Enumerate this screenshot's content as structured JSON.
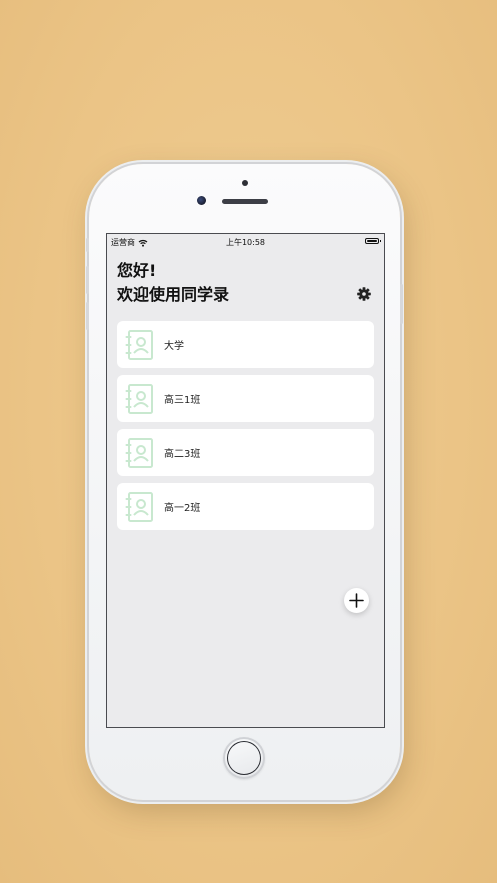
{
  "status_bar": {
    "carrier": "运营商",
    "time": "上午10:58",
    "battery_level": 1.0
  },
  "header": {
    "greeting": "您好!",
    "title": "欢迎使用同学录",
    "settings_icon": "gear-icon"
  },
  "classes": [
    {
      "label": "大学",
      "icon": "address-book-icon"
    },
    {
      "label": "高三1班",
      "icon": "address-book-icon"
    },
    {
      "label": "高二3班",
      "icon": "address-book-icon"
    },
    {
      "label": "高一2班",
      "icon": "address-book-icon"
    }
  ],
  "add_button": {
    "icon": "plus-icon"
  },
  "colors": {
    "background": "#ebc486",
    "screen_bg": "#ebebed",
    "card_bg": "#ffffff",
    "icon_accent": "#c8e8cf",
    "text": "#111111"
  }
}
